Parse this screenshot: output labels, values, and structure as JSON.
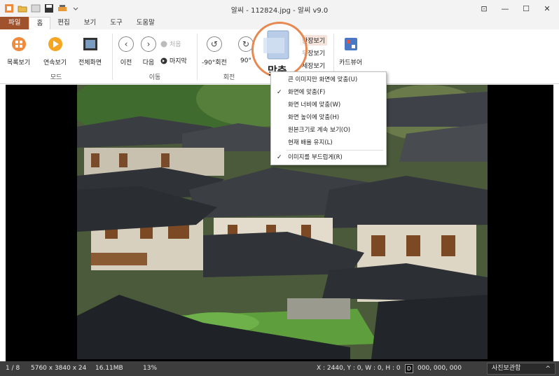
{
  "window": {
    "title": "알씨 - 112824.jpg - 알씨 v9.0",
    "controls": {
      "pin": "⊡",
      "minimize": "—",
      "maximize": "☐",
      "close": "✕"
    }
  },
  "tabs": [
    {
      "label": "파일"
    },
    {
      "label": "홈"
    },
    {
      "label": "편집"
    },
    {
      "label": "보기"
    },
    {
      "label": "도구"
    },
    {
      "label": "도움말"
    }
  ],
  "ribbon": {
    "mode": {
      "group_label": "모드",
      "list_view": "목록보기",
      "slideshow": "연속보기",
      "fullscreen": "전체화면"
    },
    "move": {
      "group_label": "이동",
      "prev": "이전",
      "next": "다음",
      "first": "처음",
      "last": "마지막"
    },
    "rotate": {
      "group_label": "회전",
      "rotate_left": "-90°회전",
      "rotate_right": "90°"
    },
    "view": {
      "fit": "맞춤",
      "opt1": "한장보기",
      "opt2": "두장보기",
      "opt3": "세장보기"
    },
    "card_viewer": "카드뷰어"
  },
  "fit_menu": {
    "items": [
      {
        "label": "큰 이미지만 화면에 맞춤(U)",
        "checked": false
      },
      {
        "label": "화면에 맞춤(F)",
        "checked": true
      },
      {
        "label": "화면 너비에 맞춤(W)",
        "checked": false
      },
      {
        "label": "화면 높이에 맞춤(H)",
        "checked": false
      },
      {
        "label": "원본크기로 계속 보기(O)",
        "checked": false
      },
      {
        "label": "현재 배율 유지(L)",
        "checked": false
      },
      {
        "label": "이미지를 부드럽게(R)",
        "checked": true
      }
    ],
    "check_glyph": "✓"
  },
  "status": {
    "index": "1 / 8",
    "dimensions": "5760 x 3840 x 24",
    "filesize": "16.11MB",
    "zoom": "13%",
    "coords": "X : 2440, Y : 0, W : 0, H : 0",
    "color_mode": "D",
    "color_value": "000, 000, 000",
    "photo_manager": "사진보관함",
    "photo_manager_arrow": "^"
  },
  "colors": {
    "file_tab": "#a0522d",
    "fit_highlight": "#e8884f",
    "status_bg": "#3d3d3d"
  }
}
